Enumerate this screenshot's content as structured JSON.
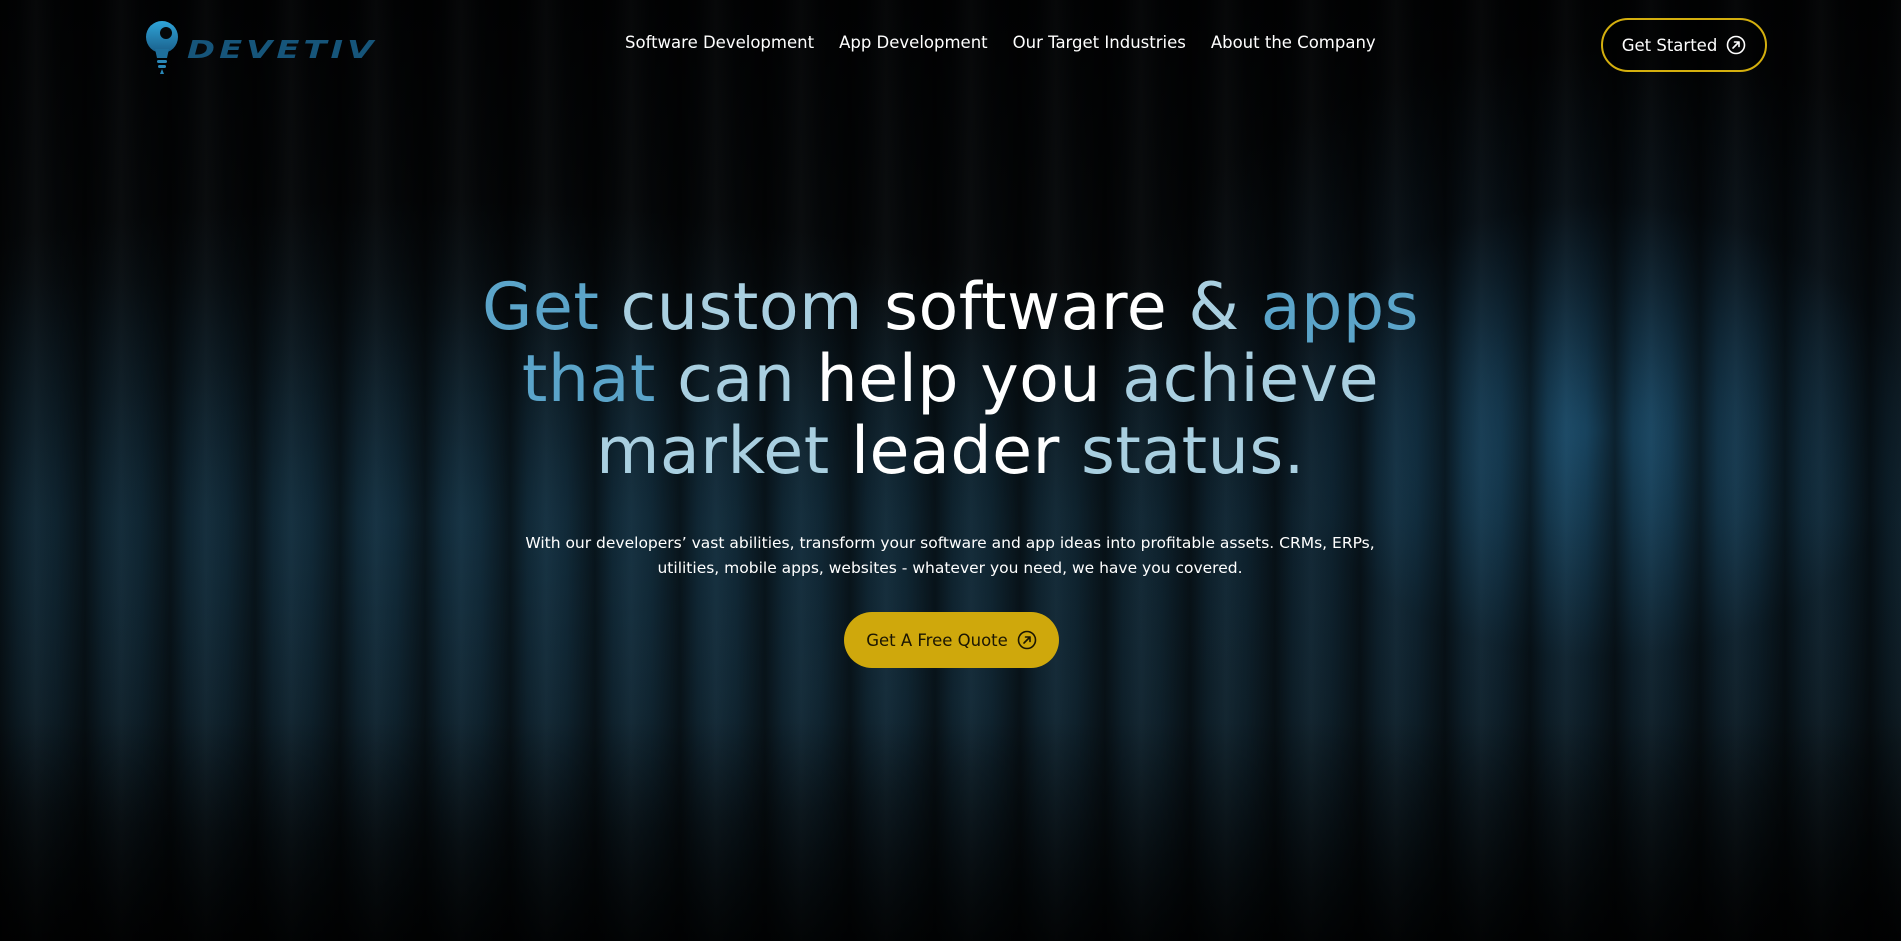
{
  "brand": {
    "name": "DEVETIV"
  },
  "nav": {
    "items": [
      {
        "label": "Software Development"
      },
      {
        "label": "App Development"
      },
      {
        "label": "Our Target Industries"
      },
      {
        "label": "About the Company"
      }
    ]
  },
  "header": {
    "cta_label": "Get Started",
    "cta_icon": "arrow-up-right-circle-icon"
  },
  "hero": {
    "title": {
      "line1": {
        "get": "Get",
        "custom": " custom",
        "software": " software",
        "amp": " &",
        "apps": " apps"
      },
      "line2": {
        "that": "that",
        "can": " can",
        "help": " help",
        "you": " you",
        "achieve": " achieve"
      },
      "line3": {
        "market": "market",
        "leader": " leader",
        "status": " status."
      }
    },
    "subtitle_line1": "With our developers’ vast abilities, transform your software and app ideas into profitable assets. CRMs, ERPs,",
    "subtitle_line2": "utilities, mobile apps, websites - whatever you need, we have you covered.",
    "cta_label": "Get A Free Quote",
    "cta_icon": "arrow-up-right-circle-icon"
  },
  "colors": {
    "accent_gold": "#d4af0e",
    "button_gold": "#cfa80c",
    "headline_blue": "#5ba4c9",
    "headline_pale": "#a9cfe0",
    "logo_blue": "#16557a"
  }
}
